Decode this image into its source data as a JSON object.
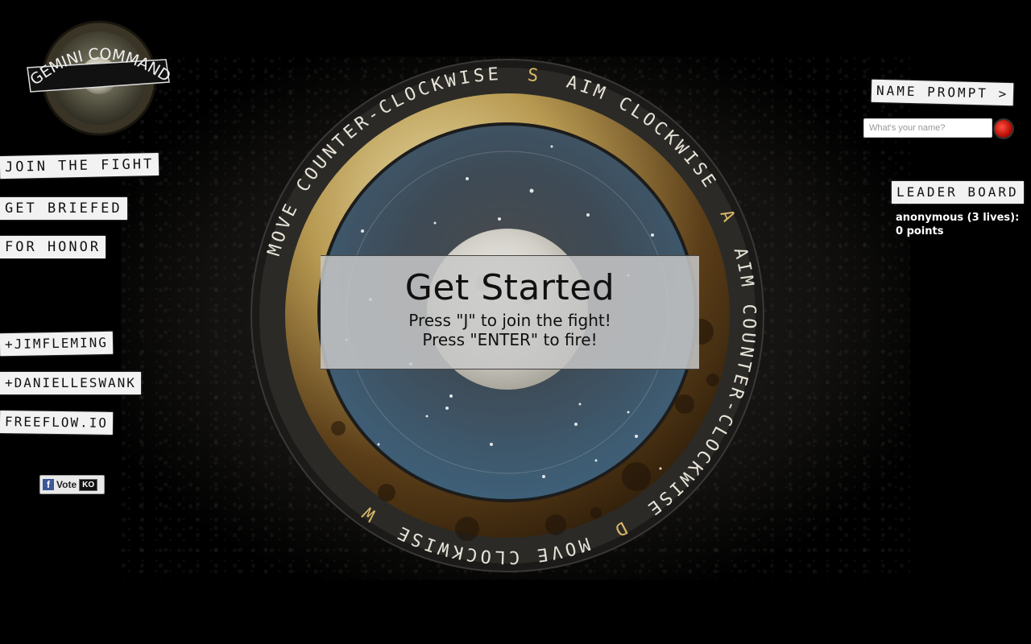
{
  "logo": {
    "text": "GEMINI COMMAND"
  },
  "nav": {
    "join_the_fight": "JOIN THE FIGHT",
    "get_briefed": "GET BRIEFED",
    "for_honor": "FOR HONOR"
  },
  "credits": {
    "jimfleming": "+JIMFLEMING",
    "danielleswank": "+DANIELLESWANK",
    "freeflow": "FREEFLOW.IO"
  },
  "vote_button": {
    "label": "Vote",
    "badge": "KO"
  },
  "name_prompt": {
    "label": "NAME PROMPT >",
    "placeholder": "What's your name?"
  },
  "leader_board": {
    "label": "LEADER BOARD",
    "entries": [
      {
        "line1": "anonymous (3 lives):",
        "line2": "0 points"
      }
    ]
  },
  "ring": {
    "top": "AIM CLOCKWISE",
    "key_top": "A",
    "right": "AIM COUNTER-CLOCKWISE",
    "key_right": "D",
    "bottom": "MOVE CLOCKWISE",
    "key_bottom": "W",
    "left": "MOVE COUNTER-CLOCKWISE",
    "key_left": "S"
  },
  "overlay": {
    "title": "Get Started",
    "line1": "Press \"J\" to join the fight!",
    "line2": "Press \"ENTER\" to fire!"
  },
  "colors": {
    "tape": "#f2f2f2",
    "ring_text": "#e8e4d8",
    "key_text": "#d9b865",
    "inner_blue": "#3e6079",
    "fire_red": "#c0140a"
  }
}
